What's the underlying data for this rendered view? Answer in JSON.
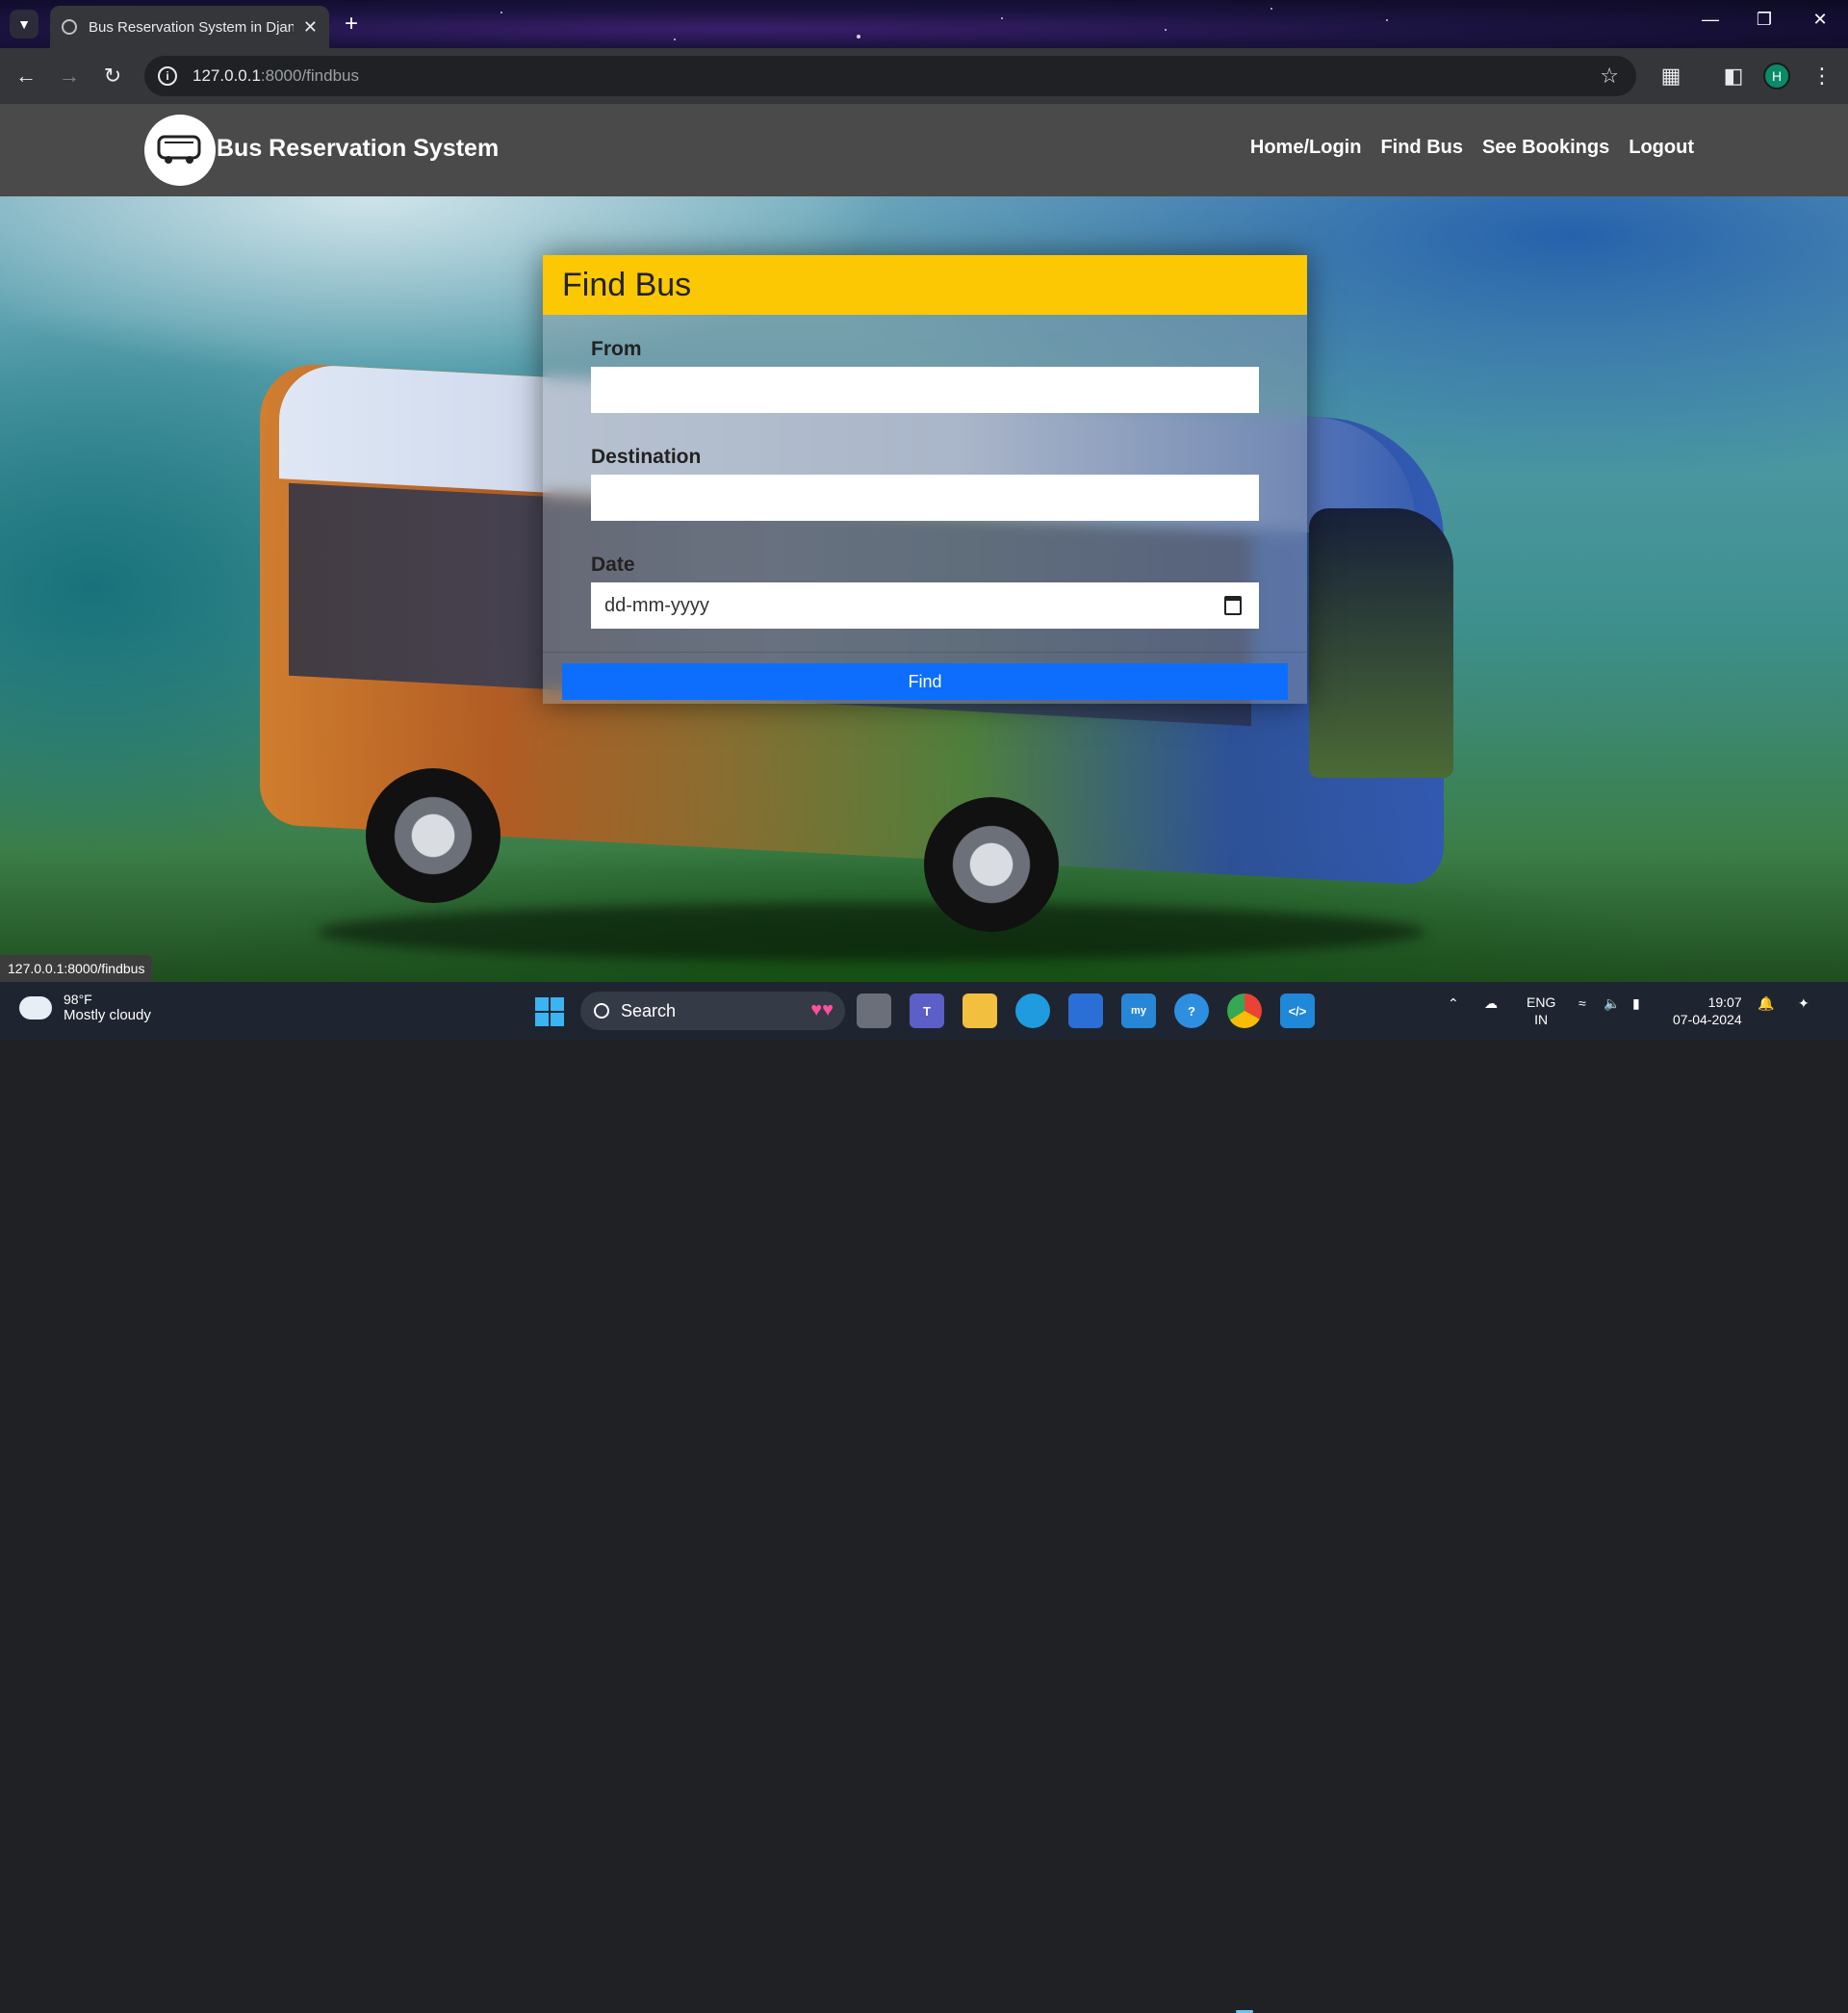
{
  "browser": {
    "tab_title": "Bus Reservation System in Djan",
    "url_host": "127.0.0.1",
    "url_path": ":8000/findbus",
    "profile_initial": "H",
    "status_url": "127.0.0.1:8000/findbus"
  },
  "site": {
    "brand": "Bus Reservation System",
    "nav": [
      "Home/Login",
      "Find Bus",
      "See Bookings",
      "Logout"
    ]
  },
  "form": {
    "heading": "Find Bus",
    "from_label": "From",
    "from_value": "",
    "destination_label": "Destination",
    "destination_value": "",
    "date_label": "Date",
    "date_placeholder": "dd-mm-yyyy",
    "submit_label": "Find",
    "header_color": "#fcc803",
    "button_color": "#0d6efd"
  },
  "taskbar": {
    "temperature": "98°F",
    "weather": "Mostly cloudy",
    "search_label": "Search",
    "lang_top": "ENG",
    "lang_bottom": "IN",
    "time": "19:07",
    "date": "07-04-2024"
  }
}
